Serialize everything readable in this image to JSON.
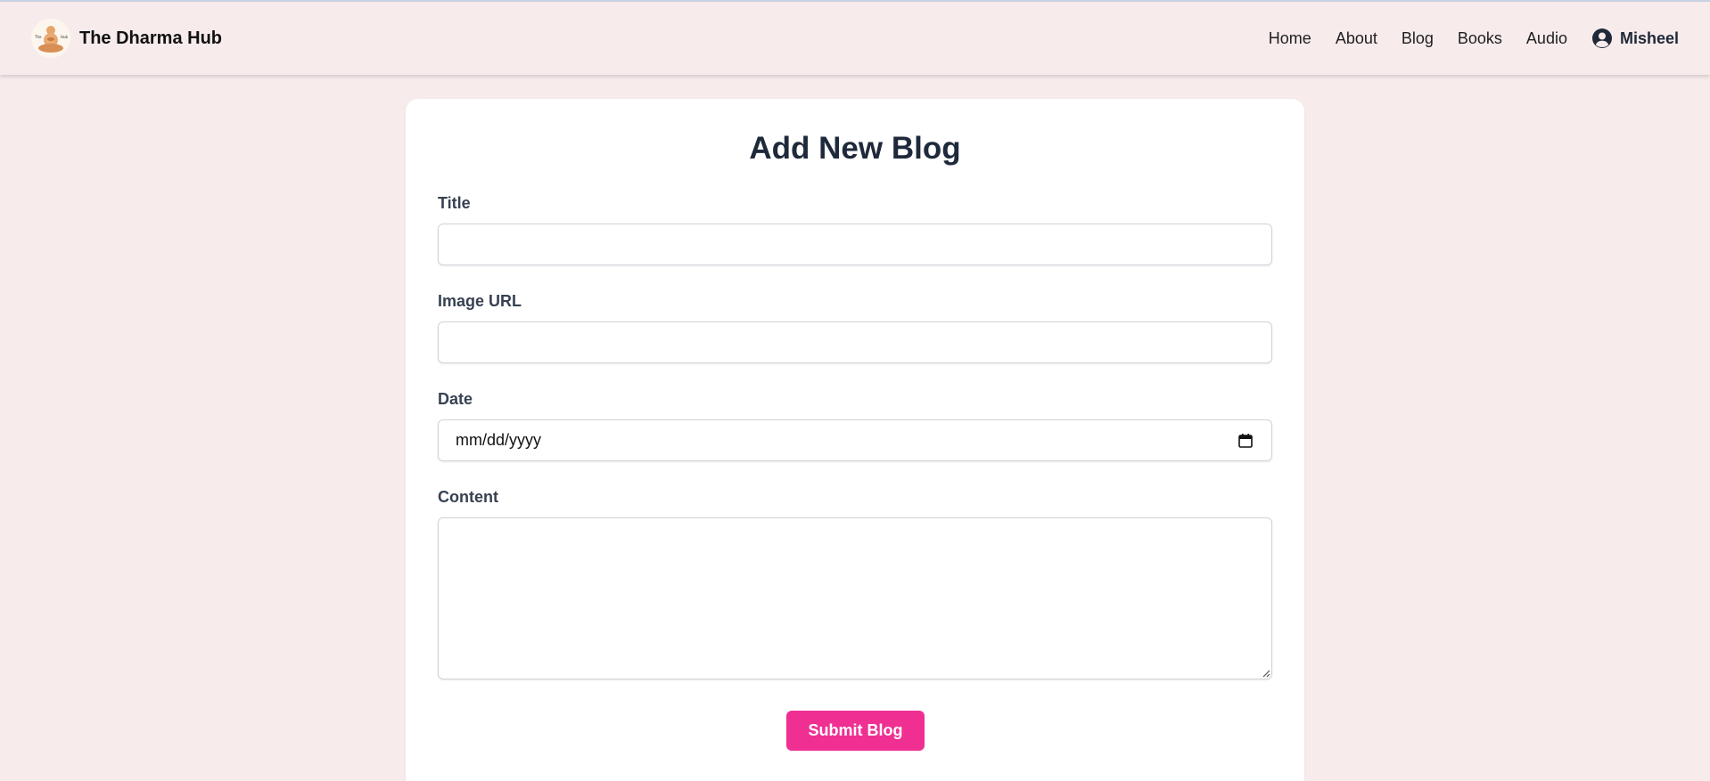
{
  "navbar": {
    "brand_name": "The Dharma Hub",
    "logo_icon": "meditating-buddha-logo",
    "links": [
      {
        "label": "Home"
      },
      {
        "label": "About"
      },
      {
        "label": "Blog"
      },
      {
        "label": "Books"
      },
      {
        "label": "Audio"
      }
    ],
    "user": {
      "icon": "user-circle-icon",
      "name": "Misheel"
    }
  },
  "form": {
    "heading": "Add New Blog",
    "fields": {
      "title": {
        "label": "Title",
        "value": ""
      },
      "image_url": {
        "label": "Image URL",
        "value": ""
      },
      "date": {
        "label": "Date",
        "placeholder": "mm/dd/yyyy",
        "icon": "calendar-icon"
      },
      "content": {
        "label": "Content",
        "value": ""
      }
    },
    "submit_label": "Submit Blog"
  },
  "colors": {
    "page_background": "#f7ebec",
    "card_background": "#ffffff",
    "heading_text": "#1e293b",
    "accent_button": "#f02f93"
  }
}
